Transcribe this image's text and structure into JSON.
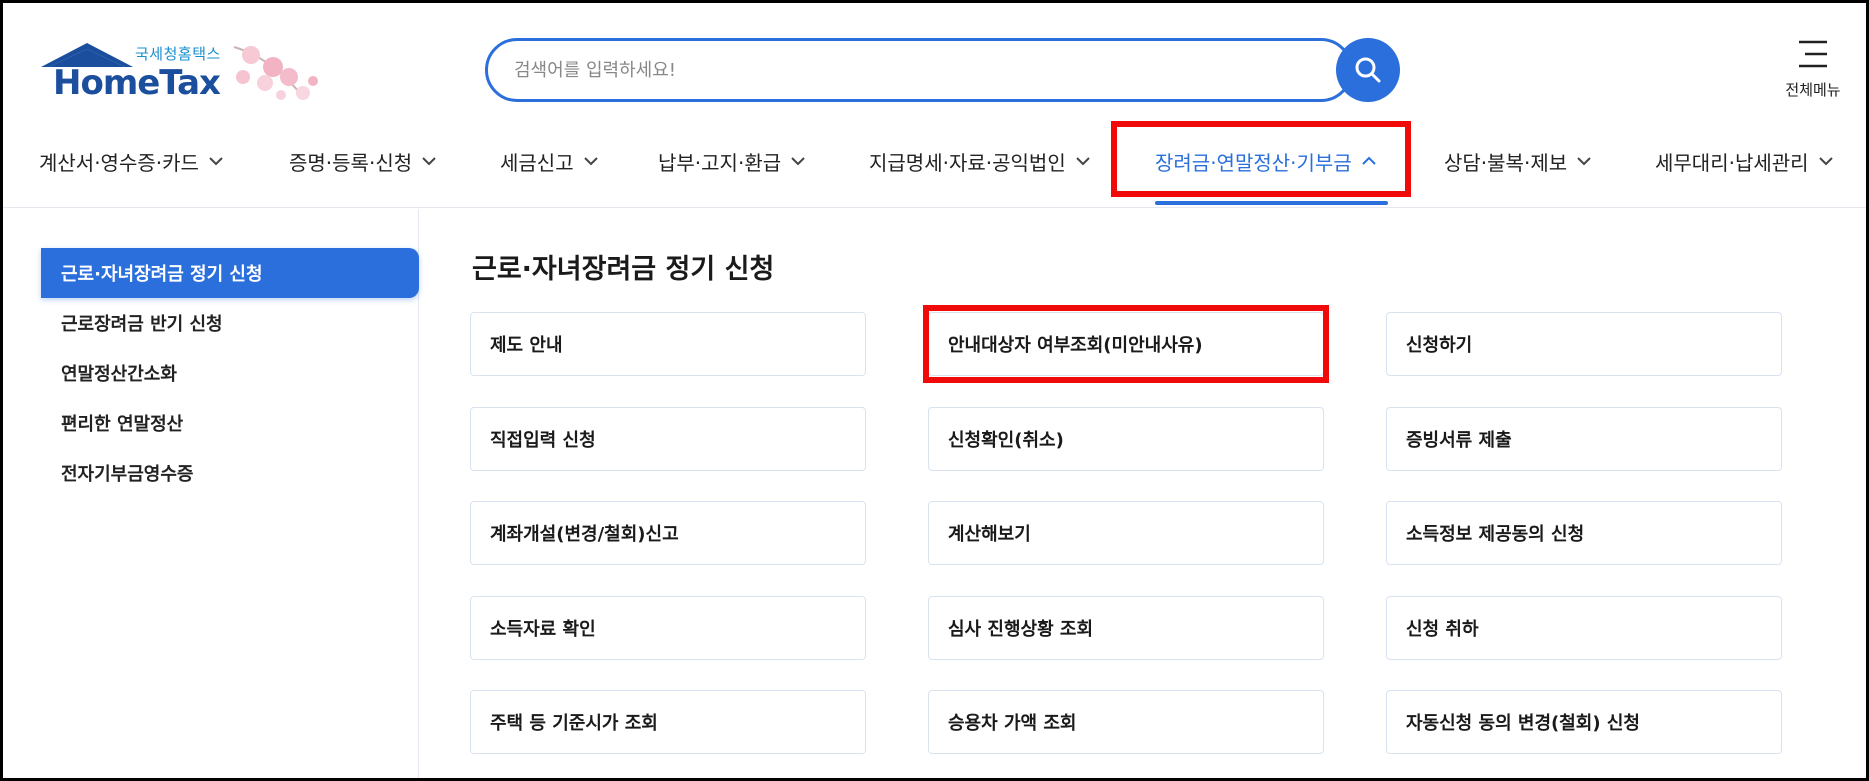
{
  "header": {
    "logo": {
      "korean": "국세청홈택스",
      "english": "HomeTax"
    },
    "search": {
      "placeholder": "검색어를 입력하세요!"
    },
    "all_menu_label": "전체메뉴"
  },
  "gnb": [
    {
      "label": "계산서·영수증·카드",
      "active": false
    },
    {
      "label": "증명·등록·신청",
      "active": false
    },
    {
      "label": "세금신고",
      "active": false
    },
    {
      "label": "납부·고지·환급",
      "active": false
    },
    {
      "label": "지급명세·자료·공익법인",
      "active": false
    },
    {
      "label": "장려금·연말정산·기부금",
      "active": true
    },
    {
      "label": "상담·불복·제보",
      "active": false
    },
    {
      "label": "세무대리·납세관리",
      "active": false
    }
  ],
  "sidebar": {
    "items": [
      {
        "label": "근로·자녀장려금 정기 신청",
        "active": true
      },
      {
        "label": "근로장려금 반기 신청",
        "active": false
      },
      {
        "label": "연말정산간소화",
        "active": false
      },
      {
        "label": "편리한 연말정산",
        "active": false
      },
      {
        "label": "전자기부금영수증",
        "active": false
      }
    ]
  },
  "content": {
    "title": "근로·자녀장려금 정기 신청",
    "cards": [
      "제도 안내",
      "안내대상자 여부조회(미안내사유)",
      "신청하기",
      "직접입력 신청",
      "신청확인(취소)",
      "증빙서류 제출",
      "계좌개설(변경/철회)신고",
      "계산해보기",
      "소득정보 제공동의 신청",
      "소득자료 확인",
      "심사 진행상황 조회",
      "신청 취하",
      "주택 등 기준시가 조회",
      "승용차 가액 조회",
      "자동신청 동의 변경(철회) 신청"
    ]
  },
  "colors": {
    "accent": "#2a6fdb",
    "highlight": "#f00a0a",
    "brand_navy": "#1b4f9e"
  }
}
